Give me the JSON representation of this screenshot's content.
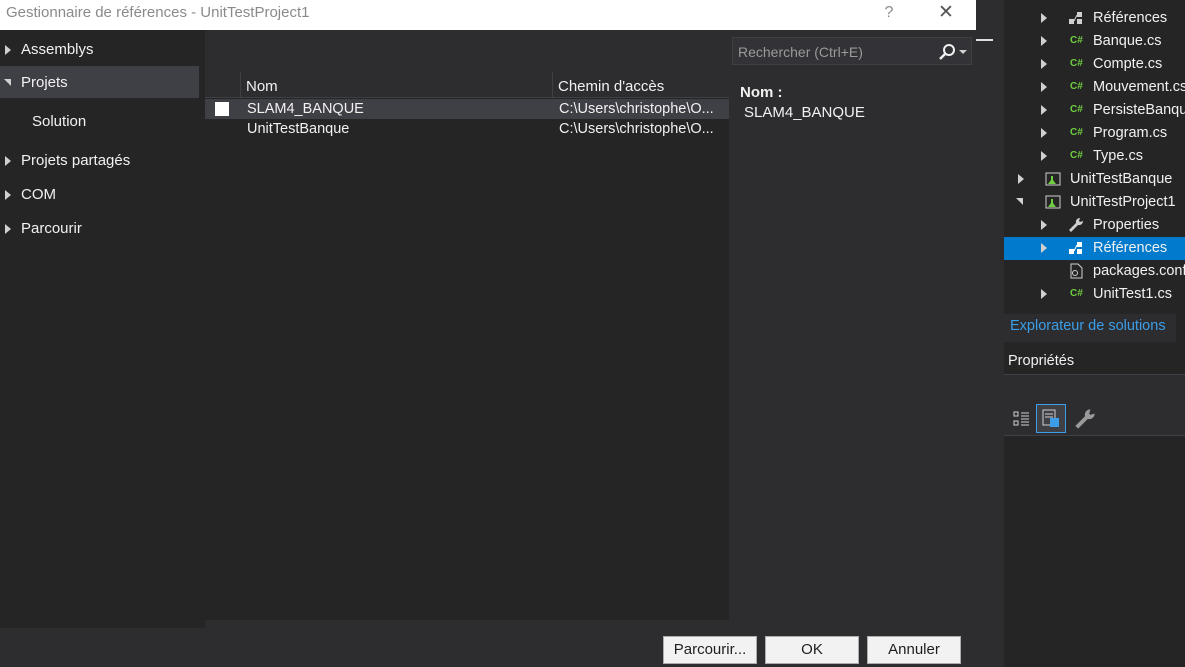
{
  "dialog": {
    "title": "Gestionnaire de références - UnitTestProject1",
    "help_label": "?",
    "close_label": "✕",
    "nav": [
      {
        "label": "Assemblys",
        "expanded": false
      },
      {
        "label": "Projets",
        "expanded": true
      },
      {
        "label": "Solution",
        "sub": true
      },
      {
        "label": "Projets partagés",
        "expanded": false
      },
      {
        "label": "COM",
        "expanded": false
      },
      {
        "label": "Parcourir",
        "expanded": false
      }
    ],
    "search": {
      "placeholder": "Rechercher (Ctrl+E)",
      "icon": "search-icon"
    },
    "columns": {
      "name": "Nom",
      "path": "Chemin d'accès"
    },
    "rows": [
      {
        "name": "SLAM4_BANQUE",
        "path": "C:\\Users\\christophe\\O...",
        "checked": false
      },
      {
        "name": "UnitTestBanque",
        "path": "C:\\Users\\christophe\\O..."
      }
    ],
    "detail": {
      "label": "Nom :",
      "value": "SLAM4_BANQUE"
    },
    "buttons": {
      "browse": "Parcourir...",
      "ok": "OK",
      "cancel": "Annuler"
    }
  },
  "solution_explorer": {
    "items": [
      {
        "label": "Références",
        "icon": "references-icon"
      },
      {
        "label": "Banque.cs",
        "icon": "csharp-file-icon"
      },
      {
        "label": "Compte.cs",
        "icon": "csharp-file-icon"
      },
      {
        "label": "Mouvement.cs",
        "icon": "csharp-file-icon"
      },
      {
        "label": "PersisteBanque.cs",
        "icon": "csharp-file-icon"
      },
      {
        "label": "Program.cs",
        "icon": "csharp-file-icon"
      },
      {
        "label": "Type.cs",
        "icon": "csharp-file-icon"
      },
      {
        "label": "UnitTestBanque",
        "icon": "test-project-icon"
      },
      {
        "label": "UnitTestProject1",
        "icon": "test-project-icon"
      },
      {
        "label": "Properties",
        "icon": "wrench-icon"
      },
      {
        "label": "Références",
        "icon": "references-icon",
        "selected": true
      },
      {
        "label": "packages.config",
        "icon": "config-file-icon"
      },
      {
        "label": "UnitTest1.cs",
        "icon": "csharp-file-icon"
      }
    ],
    "tab_label": "Explorateur de solutions",
    "csharp_badge": "C#"
  },
  "properties": {
    "title": "Propriétés",
    "toolbar_icons": [
      "categorized-icon",
      "property-pages-icon",
      "wrench-icon"
    ]
  },
  "colors": {
    "accent": "#007acc",
    "dialog_bg": "#2d2d30",
    "panel_bg": "#252526",
    "csharp_green": "#6fcf3f"
  }
}
